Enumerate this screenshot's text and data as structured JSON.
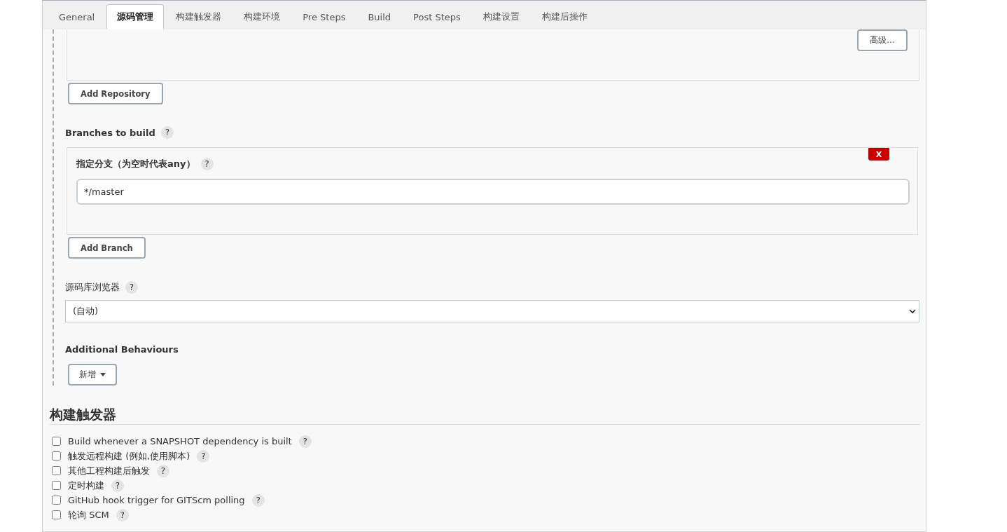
{
  "tabs": [
    {
      "label": "General",
      "selected": false
    },
    {
      "label": "源码管理",
      "selected": true
    },
    {
      "label": "构建触发器",
      "selected": false
    },
    {
      "label": "构建环境",
      "selected": false
    },
    {
      "label": "Pre Steps",
      "selected": false
    },
    {
      "label": "Build",
      "selected": false
    },
    {
      "label": "Post Steps",
      "selected": false
    },
    {
      "label": "构建设置",
      "selected": false
    },
    {
      "label": "构建后操作",
      "selected": false
    }
  ],
  "repository": {
    "advanced_button": "高级...",
    "add_button": "Add Repository"
  },
  "branches": {
    "label": "Branches to build",
    "help": "?",
    "branch_label": "指定分支（为空时代表any）",
    "branch_help": "?",
    "delete_button": "X",
    "value": "*/master",
    "add_button": "Add Branch"
  },
  "browser": {
    "label": "源码库浏览器",
    "help": "?",
    "value": "(自动)"
  },
  "behaviours": {
    "label": "Additional Behaviours",
    "add_button": "新增"
  },
  "triggers": {
    "heading": "构建触发器",
    "items": [
      {
        "label": "Build whenever a SNAPSHOT dependency is built",
        "checked": false,
        "help": "?"
      },
      {
        "label": "触发远程构建 (例如,使用脚本)",
        "checked": false,
        "help": "?"
      },
      {
        "label": "其他工程构建后触发",
        "checked": false,
        "help": "?"
      },
      {
        "label": "定时构建",
        "checked": false,
        "help": "?"
      },
      {
        "label": "GitHub hook trigger for GITScm polling",
        "checked": false,
        "help": "?"
      },
      {
        "label": "轮询 SCM",
        "checked": false,
        "help": "?"
      }
    ]
  }
}
